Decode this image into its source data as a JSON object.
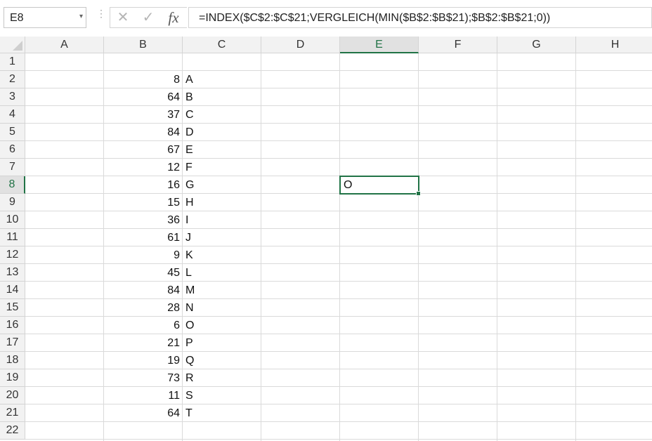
{
  "name_box": {
    "value": "E8",
    "arrow": "▾"
  },
  "formula_bar": {
    "separator": "⋮",
    "cancel_glyph": "✕",
    "enter_glyph": "✓",
    "fx_glyph": "fx",
    "formula": "=INDEX($C$2:$C$21;VERGLEICH(MIN($B$2:$B$21);$B$2:$B$21;0))"
  },
  "columns": [
    "A",
    "B",
    "C",
    "D",
    "E",
    "F",
    "G",
    "H"
  ],
  "rows": [
    "1",
    "2",
    "3",
    "4",
    "5",
    "6",
    "7",
    "8",
    "9",
    "10",
    "11",
    "12",
    "13",
    "14",
    "15",
    "16",
    "17",
    "18",
    "19",
    "20",
    "21",
    "22"
  ],
  "selected_column": "E",
  "selected_row": "8",
  "column_b_values": [
    "8",
    "64",
    "37",
    "84",
    "67",
    "12",
    "16",
    "15",
    "36",
    "61",
    "9",
    "45",
    "84",
    "28",
    "6",
    "21",
    "19",
    "73",
    "11",
    "64"
  ],
  "column_c_values": [
    "A",
    "B",
    "C",
    "D",
    "E",
    "F",
    "G",
    "H",
    "I",
    "J",
    "K",
    "L",
    "M",
    "N",
    "O",
    "P",
    "Q",
    "R",
    "S",
    "T"
  ],
  "active_cell": {
    "ref": "E8",
    "value": "O"
  },
  "colors": {
    "selection": "#217346",
    "gridline": "#dadada",
    "header_bg": "#f2f2f2"
  }
}
